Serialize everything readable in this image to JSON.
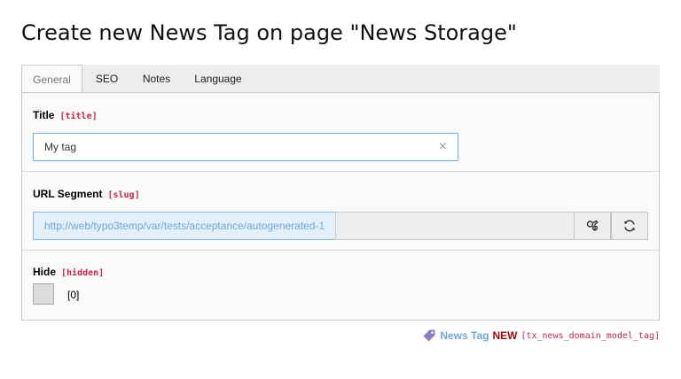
{
  "page": {
    "title": "Create new News Tag on page \"News Storage\""
  },
  "tabs": [
    {
      "label": "General",
      "active": true
    },
    {
      "label": "SEO",
      "active": false
    },
    {
      "label": "Notes",
      "active": false
    },
    {
      "label": "Language",
      "active": false
    }
  ],
  "fields": {
    "title": {
      "label": "Title",
      "code": "[title]",
      "value": "My tag"
    },
    "slug": {
      "label": "URL Segment",
      "code": "[slug]",
      "value": "http://web/typo3temp/var/tests/acceptance/autogenerated-1"
    },
    "hidden": {
      "label": "Hide",
      "code": "[hidden]",
      "value": "[0]"
    }
  },
  "footer": {
    "icon": "tag-icon",
    "record_type": "News Tag",
    "status": "NEW",
    "table": "[tx_news_domain_model_tag]"
  },
  "colors": {
    "accent_blue": "#6ea8d6",
    "field_code": "#c7254e",
    "new_status": "#a4080f"
  }
}
